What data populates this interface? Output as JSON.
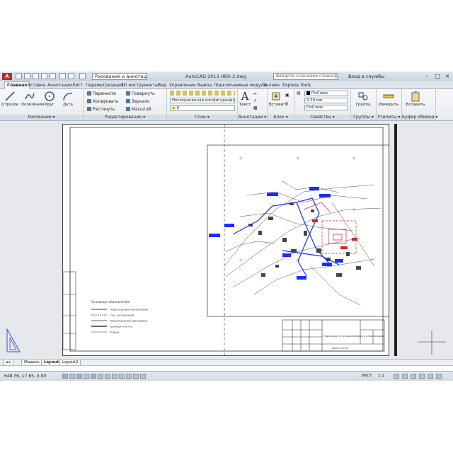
{
  "titlebar": {
    "logo": "A",
    "workspace": "Рисование и аннотации",
    "title": "AutoCAD 2013    НВК-2.dwg",
    "search_placeholder": "Введите ключевое слово/фразу",
    "sign_in": "Вход в службы"
  },
  "tabs": [
    "Главная",
    "Вставка",
    "Аннотации",
    "Лист",
    "Параметризация",
    "3D инструменты",
    "Вид",
    "Управление",
    "Вывод",
    "Подключаемые модули",
    "Онлайн",
    "Express Tools"
  ],
  "ribbon": {
    "draw": {
      "title": "Рисование",
      "tools": [
        "Отрезок",
        "Полилиния",
        "Круг",
        "Дуга"
      ]
    },
    "modify": {
      "title": "Редактирование",
      "tools": [
        "Перенести",
        "Повернуть",
        "Копировать",
        "Зеркало",
        "Растянуть",
        "Масштаб"
      ]
    },
    "layers": {
      "title": "Слои",
      "layer_state": "Несохраненная конфигурация сло",
      "current_layer": "0"
    },
    "annotation": {
      "title": "Аннотации",
      "tools": [
        "Текст",
        "Вставить"
      ]
    },
    "block": {
      "title": "Блок"
    },
    "properties": {
      "title": "Свойства",
      "color": "ПоСлою",
      "lineweight": "0.20 мм",
      "linetype": "ПоСлою"
    },
    "groups": {
      "title": "Группы",
      "tool": "Группа"
    },
    "utilities": {
      "title": "Утилиты",
      "tool": "Измерить"
    },
    "clipboard": {
      "title": "Буфер обмена",
      "tool": "Вставить"
    }
  },
  "drawing": {
    "legend_title": "Условные обозначения",
    "legend_items": [
      "Проектируемая канализация",
      "Сущ. канализация",
      "Проектируемый водопровод",
      "Границы участка",
      "Разрыв"
    ],
    "stamp_text": "Наружные сети водопровода и канализации",
    "stamp_sheet": "План сетей",
    "colors": {
      "pipe_blue": "#1a2cff",
      "pipe_red": "#e02020",
      "linework": "#3a3a3a"
    }
  },
  "layout_tabs": [
    "Модель",
    "Layout1",
    "Layout2"
  ],
  "status": {
    "coords": "648.36, 17.65, 0.00",
    "right_label": "ЛИСТ",
    "scale": "1:1"
  }
}
